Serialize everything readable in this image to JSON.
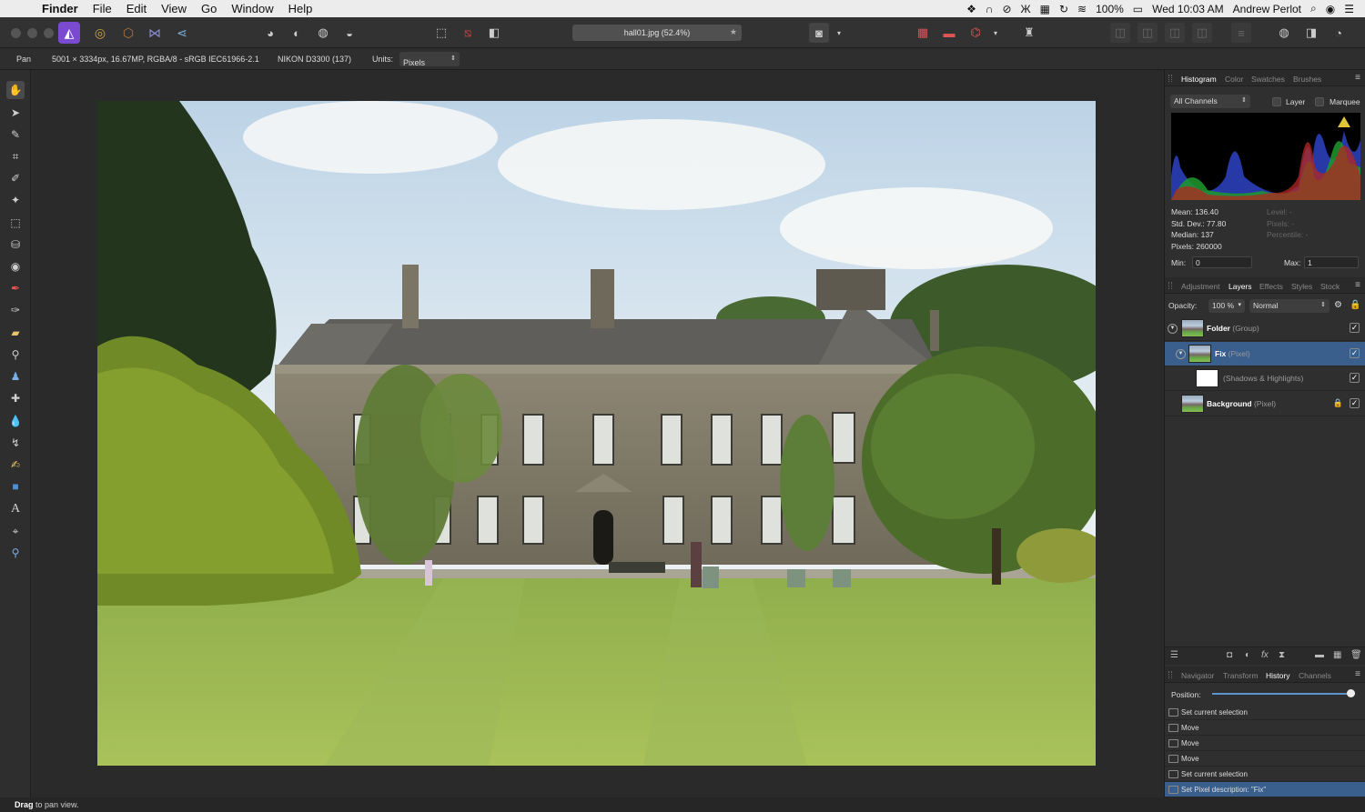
{
  "menubar": {
    "app_name": "Finder",
    "items": [
      "File",
      "Edit",
      "View",
      "Go",
      "Window",
      "Help"
    ],
    "battery": "100%",
    "datetime": "Wed 10:03 AM",
    "user": "Andrew Perlot"
  },
  "document": {
    "tab_title": "hall01.jpg (52.4%)",
    "info": "5001 × 3334px, 16.67MP, RGBA/8 - sRGB IEC61966-2.1",
    "camera": "NIKON D3300 (137)",
    "units_label": "Units:",
    "units_value": "Pixels"
  },
  "context": {
    "tool_name": "Pan"
  },
  "histogram_panel": {
    "tabs": [
      "Histogram",
      "Color",
      "Swatches",
      "Brushes"
    ],
    "active_tab": "Histogram",
    "channel_select": "All Channels",
    "layer_label": "Layer",
    "marquee_label": "Marquee",
    "stats": {
      "mean": "Mean: 136.40",
      "std_dev": "Std. Dev.: 77.80",
      "median": "Median: 137",
      "pixels": "Pixels: 260000",
      "level": "Level: -",
      "pixels_sel": "Pixels: -",
      "percentile": "Percentile: -"
    },
    "min_label": "Min:",
    "min_value": "0",
    "max_label": "Max:",
    "max_value": "1"
  },
  "layers_panel": {
    "tabs": [
      "Adjustment",
      "Layers",
      "Effects",
      "Styles",
      "Stock"
    ],
    "active_tab": "Layers",
    "opacity_label": "Opacity:",
    "opacity_value": "100 %",
    "blend_mode": "Normal",
    "layers": [
      {
        "name": "Folder",
        "type": "(Group)"
      },
      {
        "name": "Fix",
        "type": "(Pixel)"
      },
      {
        "name": "",
        "type": "(Shadows & Highlights)"
      },
      {
        "name": "Background",
        "type": "(Pixel)"
      }
    ]
  },
  "history_panel": {
    "tabs": [
      "Navigator",
      "Transform",
      "History",
      "Channels"
    ],
    "active_tab": "History",
    "position_label": "Position:",
    "position_value": 1.0,
    "items": [
      "Set current selection",
      "Move",
      "Move",
      "Move",
      "Set current selection",
      "Set Pixel description: \"Fix\""
    ]
  },
  "statusbar": {
    "bold": "Drag",
    "text": " to pan view."
  },
  "colors": {
    "selection": "#3a5f8c",
    "accent": "#5e93d1"
  }
}
